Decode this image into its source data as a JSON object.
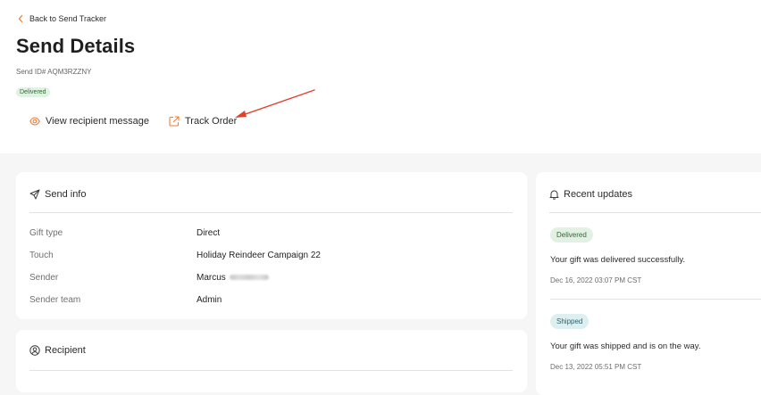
{
  "header": {
    "back_label": "Back to Send Tracker",
    "title": "Send Details",
    "send_id": "Send ID# AQM3RZZNY",
    "status": "Delivered"
  },
  "actions": {
    "view_message_label": "View recipient message",
    "track_order_label": "Track Order"
  },
  "send_info": {
    "title": "Send info",
    "rows": [
      {
        "label": "Gift type",
        "value": "Direct"
      },
      {
        "label": "Touch",
        "value": "Holiday Reindeer Campaign 22"
      },
      {
        "label": "Sender",
        "value": "Marcus"
      },
      {
        "label": "Sender team",
        "value": "Admin"
      }
    ]
  },
  "recipient": {
    "title": "Recipient"
  },
  "updates": {
    "title": "Recent updates",
    "items": [
      {
        "status": "Delivered",
        "message": "Your gift was delivered successfully.",
        "time": "Dec 16, 2022 03:07 PM CST"
      },
      {
        "status": "Shipped",
        "message": "Your gift was shipped and is on the way.",
        "time": "Dec 13, 2022 05:51 PM CST"
      }
    ]
  },
  "colors": {
    "accent_orange": "#ee7d3a",
    "arrow_red": "#e0412c",
    "delivered_bg": "#e3f1e4",
    "shipped_bg": "#ddeff0"
  }
}
